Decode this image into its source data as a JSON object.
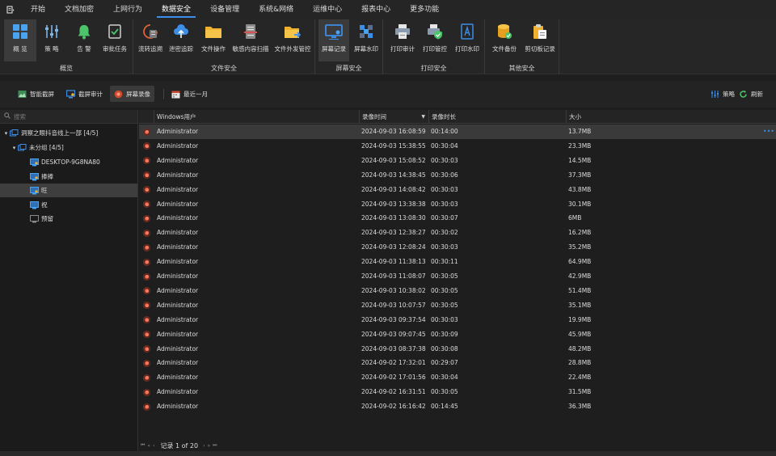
{
  "menu": {
    "app_icon": "app-menu-icon",
    "items": [
      {
        "label": "开始"
      },
      {
        "label": "文档加密"
      },
      {
        "label": "上网行为"
      },
      {
        "label": "数据安全"
      },
      {
        "label": "设备管理"
      },
      {
        "label": "系统&网络"
      },
      {
        "label": "运维中心"
      },
      {
        "label": "报表中心"
      },
      {
        "label": "更多功能"
      }
    ],
    "active_index": 3
  },
  "ribbon": {
    "groups": [
      {
        "label": "概览",
        "buttons": [
          {
            "label": "概 览",
            "icon": "dashboard-icon"
          },
          {
            "label": "策 略",
            "icon": "sliders-icon"
          },
          {
            "label": "告 警",
            "icon": "bell-icon"
          },
          {
            "label": "审批任务",
            "icon": "checklist-icon"
          }
        ]
      },
      {
        "label": "文件安全",
        "buttons": [
          {
            "label": "流转追溯",
            "icon": "trace-icon"
          },
          {
            "label": "泄密追踪",
            "icon": "cloud-upload-icon"
          },
          {
            "label": "文件操作",
            "icon": "folder-icon"
          },
          {
            "label": "敏感内容扫描",
            "icon": "scanner-icon"
          },
          {
            "label": "文件外发管控",
            "icon": "folder-send-icon"
          }
        ]
      },
      {
        "label": "屏幕安全",
        "buttons": [
          {
            "label": "屏幕记录",
            "icon": "screen-record-icon"
          },
          {
            "label": "屏幕水印",
            "icon": "watermark-icon"
          }
        ]
      },
      {
        "label": "打印安全",
        "buttons": [
          {
            "label": "打印审计",
            "icon": "printer-icon"
          },
          {
            "label": "打印管控",
            "icon": "printer-shield-icon"
          },
          {
            "label": "打印水印",
            "icon": "document-a-icon"
          }
        ]
      },
      {
        "label": "其他安全",
        "buttons": [
          {
            "label": "文件备份",
            "icon": "database-backup-icon"
          },
          {
            "label": "剪切板记录",
            "icon": "clipboard-icon"
          }
        ]
      }
    ]
  },
  "toolbar": {
    "smart_capture": "智能截屏",
    "capture_audit": "截屏审计",
    "screen_recording": "屏幕录像",
    "date_range": "最近一月",
    "policy": "策略",
    "refresh": "刷新"
  },
  "tree": {
    "search_placeholder": "搜索",
    "nodes": [
      {
        "label": "洞察之眼抖音线上一部  [4/5]",
        "level": 0,
        "expanded": true
      },
      {
        "label": "未分组  [4/5]",
        "level": 1,
        "expanded": true
      },
      {
        "label": "DESKTOP-9G8NA80",
        "level": 2
      },
      {
        "label": "捧捧",
        "level": 2
      },
      {
        "label": "旺",
        "level": 2,
        "selected": true
      },
      {
        "label": "祝",
        "level": 2
      },
      {
        "label": "预留",
        "level": 2,
        "offline": true
      }
    ]
  },
  "grid": {
    "columns": {
      "user": "Windows用户",
      "time": "录像时间",
      "duration": "录像时长",
      "size": "大小"
    },
    "rows": [
      {
        "user": "Administrator",
        "time": "2024-09-03 16:08:59",
        "duration": "00:14:00",
        "size": "13.7MB",
        "selected": true
      },
      {
        "user": "Administrator",
        "time": "2024-09-03 15:38:55",
        "duration": "00:30:04",
        "size": "23.3MB"
      },
      {
        "user": "Administrator",
        "time": "2024-09-03 15:08:52",
        "duration": "00:30:03",
        "size": "14.5MB"
      },
      {
        "user": "Administrator",
        "time": "2024-09-03 14:38:45",
        "duration": "00:30:06",
        "size": "37.3MB"
      },
      {
        "user": "Administrator",
        "time": "2024-09-03 14:08:42",
        "duration": "00:30:03",
        "size": "43.8MB"
      },
      {
        "user": "Administrator",
        "time": "2024-09-03 13:38:38",
        "duration": "00:30:03",
        "size": "30.1MB"
      },
      {
        "user": "Administrator",
        "time": "2024-09-03 13:08:30",
        "duration": "00:30:07",
        "size": "6MB"
      },
      {
        "user": "Administrator",
        "time": "2024-09-03 12:38:27",
        "duration": "00:30:02",
        "size": "16.2MB"
      },
      {
        "user": "Administrator",
        "time": "2024-09-03 12:08:24",
        "duration": "00:30:03",
        "size": "35.2MB"
      },
      {
        "user": "Administrator",
        "time": "2024-09-03 11:38:13",
        "duration": "00:30:11",
        "size": "64.9MB"
      },
      {
        "user": "Administrator",
        "time": "2024-09-03 11:08:07",
        "duration": "00:30:05",
        "size": "42.9MB"
      },
      {
        "user": "Administrator",
        "time": "2024-09-03 10:38:02",
        "duration": "00:30:05",
        "size": "51.4MB"
      },
      {
        "user": "Administrator",
        "time": "2024-09-03 10:07:57",
        "duration": "00:30:05",
        "size": "35.1MB"
      },
      {
        "user": "Administrator",
        "time": "2024-09-03 09:37:54",
        "duration": "00:30:03",
        "size": "19.9MB"
      },
      {
        "user": "Administrator",
        "time": "2024-09-03 09:07:45",
        "duration": "00:30:09",
        "size": "45.9MB"
      },
      {
        "user": "Administrator",
        "time": "2024-09-03 08:37:38",
        "duration": "00:30:08",
        "size": "48.2MB"
      },
      {
        "user": "Administrator",
        "time": "2024-09-02 17:32:01",
        "duration": "00:29:07",
        "size": "28.8MB"
      },
      {
        "user": "Administrator",
        "time": "2024-09-02 17:01:56",
        "duration": "00:30:04",
        "size": "22.4MB"
      },
      {
        "user": "Administrator",
        "time": "2024-09-02 16:31:51",
        "duration": "00:30:05",
        "size": "31.5MB"
      },
      {
        "user": "Administrator",
        "time": "2024-09-02 16:16:42",
        "duration": "00:14:45",
        "size": "36.3MB"
      }
    ]
  },
  "pager": {
    "label": "记录 1 of 20"
  },
  "colors": {
    "accent": "#3c8ee6",
    "record": "#d04a30",
    "selected_row": "#3a3a3a"
  }
}
